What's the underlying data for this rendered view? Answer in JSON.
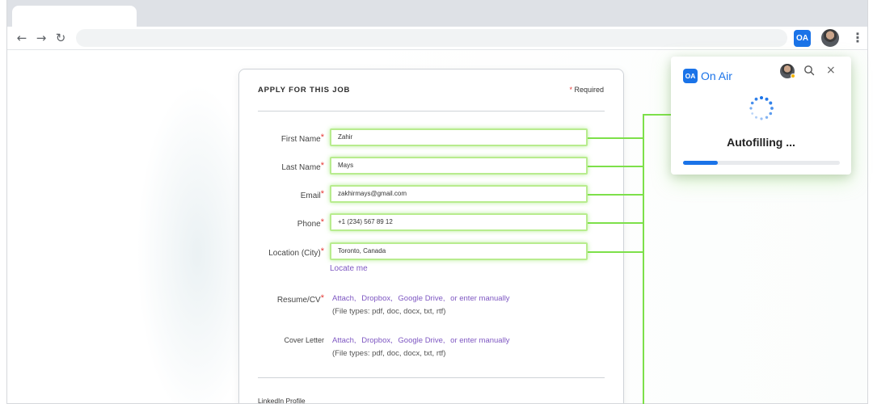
{
  "extension": {
    "icon_text": "OA",
    "brand": "On Air",
    "status": "Autofilling ...",
    "progress": 0.22
  },
  "form": {
    "title": "APPLY FOR THIS JOB",
    "required_mark": "*",
    "required_note": "Required",
    "fields": [
      {
        "label": "First Name",
        "value": "Zahir"
      },
      {
        "label": "Last Name",
        "value": "Mays"
      },
      {
        "label": "Email",
        "value": "zakhirmays@gmail.com"
      },
      {
        "label": "Phone",
        "value": "+1 (234) 567 89 12"
      },
      {
        "label": "Location (City)",
        "value": "Toronto, Canada"
      }
    ],
    "locate_link": "Locate me",
    "resume": {
      "label": "Resume/CV",
      "attach": "Attach,",
      "dropbox": "Dropbox,",
      "gdrive": "Google Drive,",
      "manual": "or enter manually",
      "filetypes": "(File types: pdf, doc, docx, txt, rtf)"
    },
    "cover_letter": {
      "label": "Cover Letter",
      "attach": "Attach,",
      "dropbox": "Dropbox,",
      "gdrive": "Google Drive,",
      "manual": "or enter manually",
      "filetypes": "(File types: pdf, doc, docx, txt, rtf)"
    },
    "linkedin_label": "LinkedIn Profile"
  },
  "colors": {
    "accent": "#1a73e8",
    "link": "#7e57c2",
    "highlight": "#7de04a",
    "required": "#e53935"
  },
  "icons": [
    "back-arrow-icon",
    "forward-arrow-icon",
    "reload-icon",
    "kebab-menu-icon",
    "search-icon",
    "close-icon",
    "spinner-icon"
  ]
}
